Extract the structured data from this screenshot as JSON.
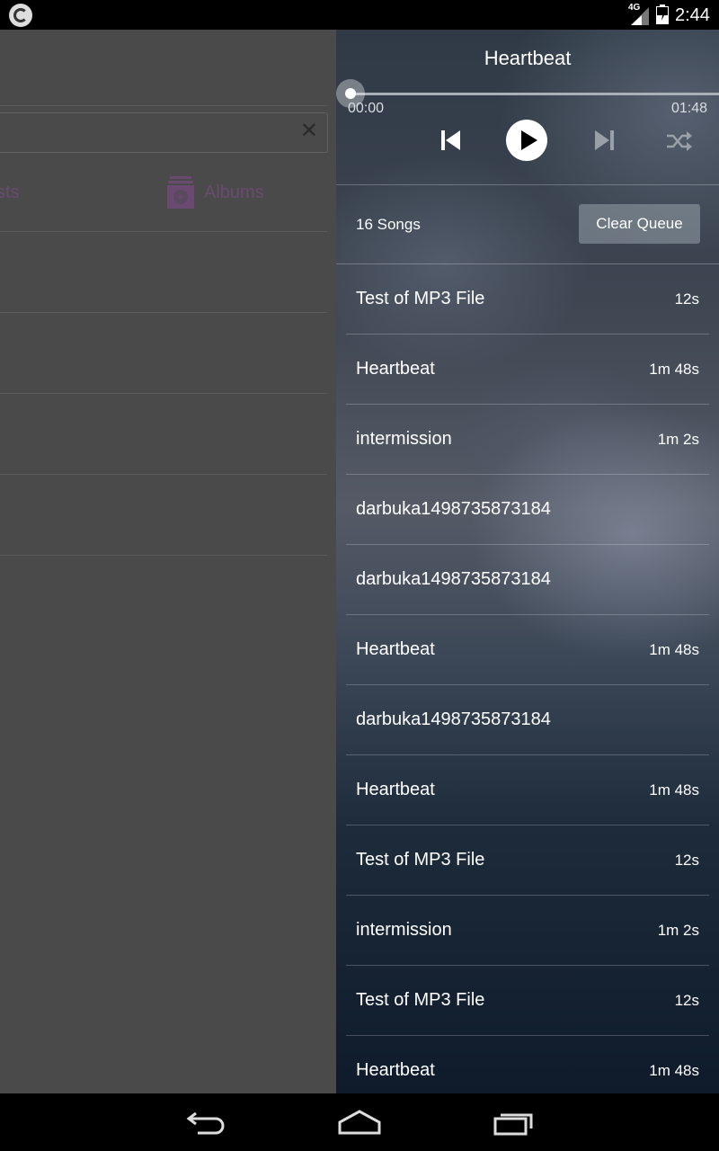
{
  "status_bar": {
    "network": "4G",
    "time": "2:44"
  },
  "background_app": {
    "tab_artists_partial": "sts",
    "tab_albums": "Albums",
    "search_clear": "✕"
  },
  "player": {
    "title": "Heartbeat",
    "elapsed": "00:00",
    "total": "01:48",
    "progress": 0.0,
    "song_count": "16 Songs",
    "clear_queue_label": "Clear Queue",
    "icons": {
      "prev": "skip-previous-icon",
      "play": "play-icon",
      "next": "skip-next-icon",
      "shuffle": "shuffle-icon"
    },
    "queue": [
      {
        "title": "Test of MP3 File",
        "duration": "12s"
      },
      {
        "title": "Heartbeat",
        "duration": "1m 48s"
      },
      {
        "title": "intermission",
        "duration": "1m 2s"
      },
      {
        "title": "darbuka1498735873184",
        "duration": ""
      },
      {
        "title": "darbuka1498735873184",
        "duration": ""
      },
      {
        "title": "Heartbeat",
        "duration": "1m 48s"
      },
      {
        "title": "darbuka1498735873184",
        "duration": ""
      },
      {
        "title": "Heartbeat",
        "duration": "1m 48s"
      },
      {
        "title": "Test of MP3 File",
        "duration": "12s"
      },
      {
        "title": "intermission",
        "duration": "1m 2s"
      },
      {
        "title": "Test of MP3 File",
        "duration": "12s"
      },
      {
        "title": "Heartbeat",
        "duration": "1m 48s"
      }
    ]
  },
  "nav_bar": {
    "back": "back-icon",
    "home": "home-icon",
    "recents": "recents-icon"
  }
}
